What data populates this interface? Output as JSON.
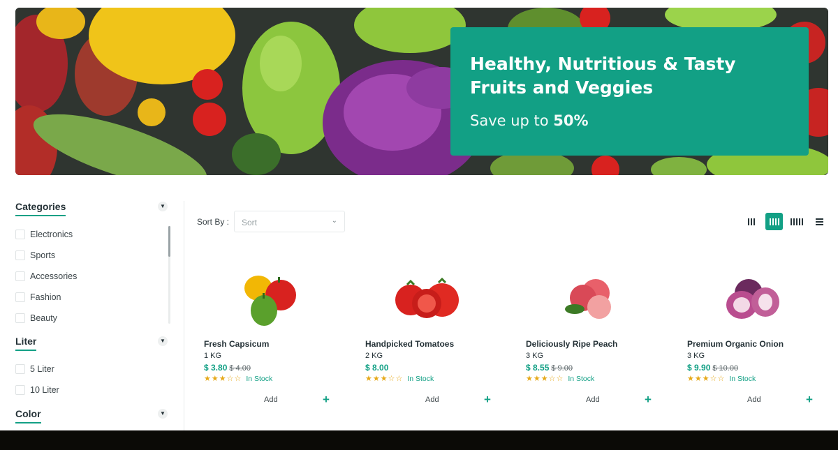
{
  "hero": {
    "title": "Healthy, Nutritious & Tasty Fruits and Veggies",
    "subtitle_prefix": "Save up to ",
    "subtitle_highlight": "50%",
    "accent_color": "#12a085"
  },
  "filters": {
    "categories": {
      "title": "Categories",
      "items": [
        "Electronics",
        "Sports",
        "Accessories",
        "Fashion",
        "Beauty"
      ]
    },
    "liter": {
      "title": "Liter",
      "items": [
        "5 Liter",
        "10 Liter"
      ]
    },
    "color": {
      "title": "Color"
    }
  },
  "toolbar": {
    "sort_label": "Sort By :",
    "sort_placeholder": "Sort",
    "view_modes": [
      "grid-3-icon",
      "grid-4-icon",
      "grid-5-icon",
      "list-icon"
    ],
    "active_view": "grid-4-icon"
  },
  "products": [
    {
      "name": "Fresh Capsicum",
      "weight": "1 KG",
      "price": "$ 3.80",
      "old_price": "$ 4.00",
      "rating": 3,
      "stock": "In Stock",
      "add": "Add"
    },
    {
      "name": "Handpicked Tomatoes",
      "weight": "2 KG",
      "price": "$ 8.00",
      "old_price": "",
      "rating": 3,
      "stock": "In Stock",
      "add": "Add"
    },
    {
      "name": "Deliciously Ripe Peach",
      "weight": "3 KG",
      "price": "$ 8.55",
      "old_price": "$ 9.00",
      "rating": 3,
      "stock": "In Stock",
      "add": "Add"
    },
    {
      "name": "Premium Organic Onion",
      "weight": "3 KG",
      "price": "$ 9.90",
      "old_price": "$ 10.00",
      "rating": 3,
      "stock": "In Stock",
      "add": "Add"
    }
  ],
  "icons": {
    "add": "plus-icon",
    "star": "star-icon",
    "chevron": "chevron-down-icon"
  }
}
